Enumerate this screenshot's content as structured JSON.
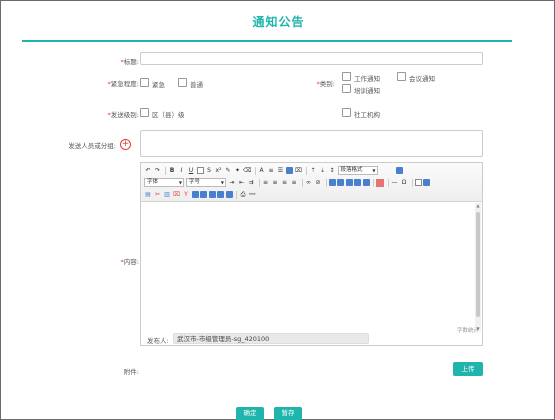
{
  "page": {
    "title": "通知公告"
  },
  "form": {
    "title_label": "标题:",
    "title_value": "",
    "urgency_label": "紧急程度:",
    "urgency_options": [
      "紧急",
      "普通"
    ],
    "category_label": "类别:",
    "category_options": [
      "工作通知",
      "会议通知",
      "培训通知"
    ],
    "send_level_label": "发送级别:",
    "send_level_options": [
      "区（县）级",
      "社工机构"
    ],
    "recipients_label": "发送人员或分组:",
    "content_label": "内容:",
    "attachment_label": "附件:",
    "upload_label": "上传"
  },
  "editor": {
    "font_family": "字体",
    "font_size": "字号",
    "paragraph_format": "段落格式",
    "word_count_label": "字数统计",
    "sender_label": "发布人:",
    "sender_value": "武汉市-市级管理员-sg_420100"
  },
  "actions": {
    "confirm_label": "确定",
    "save_label": "暂存"
  },
  "colors": {
    "accent": "#1fb5ac",
    "required": "#e53935"
  }
}
